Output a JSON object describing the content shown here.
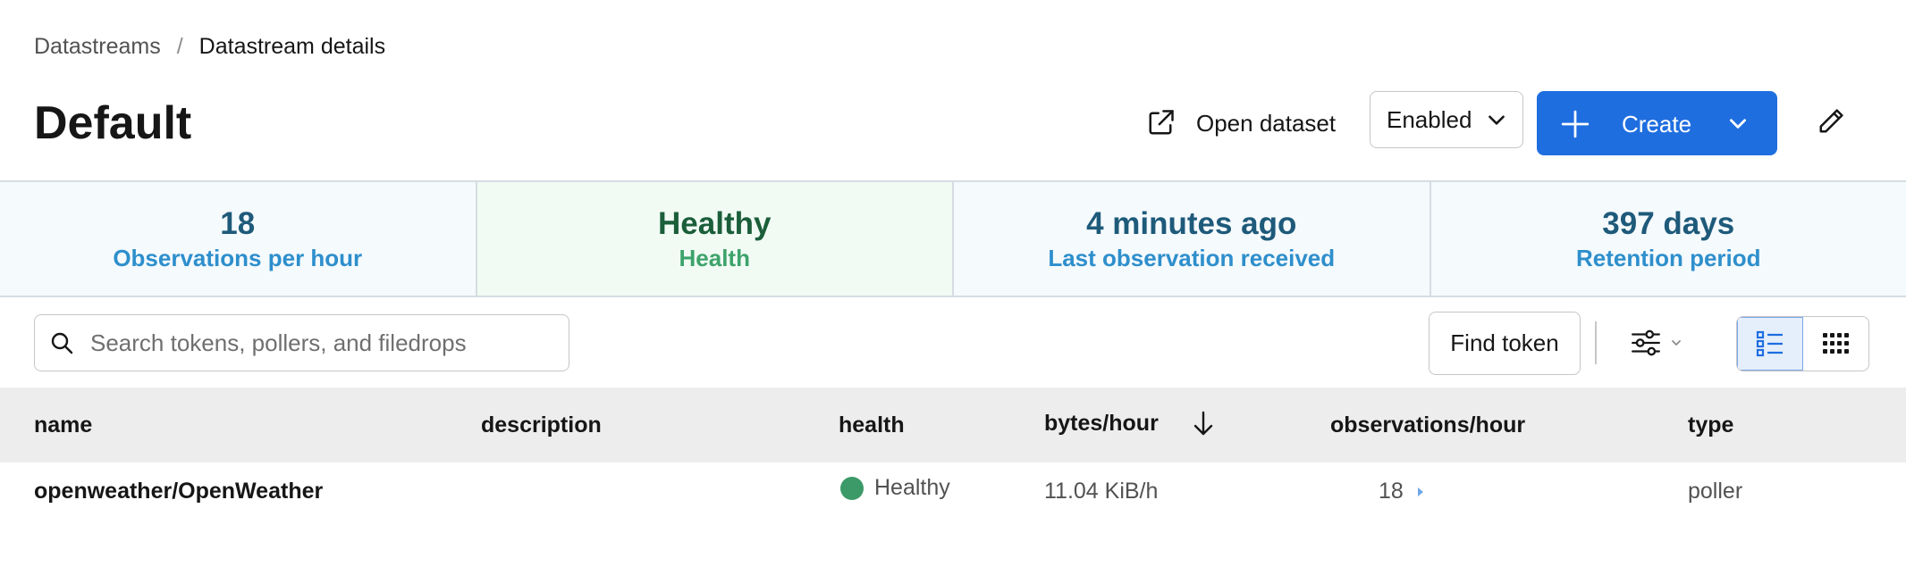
{
  "breadcrumb": {
    "parent": "Datastreams",
    "separator": "/",
    "current": "Datastream details"
  },
  "page": {
    "title": "Default"
  },
  "header_actions": {
    "open_dataset_label": "Open dataset",
    "status_select_value": "Enabled",
    "create_label": "Create"
  },
  "stats": [
    {
      "value": "18",
      "label": "Observations per hour"
    },
    {
      "value": "Healthy",
      "label": "Health"
    },
    {
      "value": "4 minutes ago",
      "label": "Last observation received"
    },
    {
      "value": "397 days",
      "label": "Retention period"
    }
  ],
  "toolbar": {
    "search_placeholder": "Search tokens, pollers, and filedrops",
    "find_token_label": "Find token"
  },
  "table": {
    "columns": [
      "name",
      "description",
      "health",
      "bytes/hour",
      "observations/hour",
      "type"
    ],
    "sorted_column": "bytes/hour",
    "sort_direction": "descending",
    "rows": [
      {
        "name": "openweather/OpenWeather",
        "description": "",
        "health": "Healthy",
        "bytes_per_hour": "11.04 KiB/h",
        "observations_per_hour": "18",
        "type": "poller"
      }
    ]
  },
  "colors": {
    "primary": "#1f6ee0",
    "healthy": "#3c9a68",
    "stat_value": "#1e5a7a",
    "stat_label": "#2e8fcc"
  },
  "icons": {
    "open_dataset": "external-link-icon",
    "select": "chevron-down-icon",
    "create": "plus-icon",
    "edit": "pencil-icon",
    "search": "search-icon",
    "filter": "sliders-icon",
    "list_view": "list-view-icon",
    "grid_view": "grid-view-icon",
    "sort": "arrow-down-icon"
  }
}
